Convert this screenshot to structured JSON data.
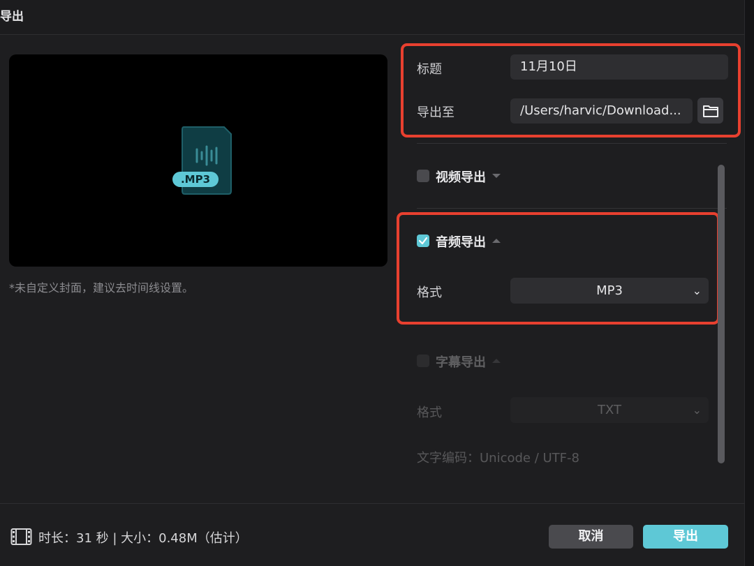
{
  "window": {
    "title": "导出"
  },
  "preview": {
    "file_badge": ".MP3",
    "cover_note": "*未自定义封面，建议去时间线设置。"
  },
  "general": {
    "title_label": "标题",
    "title_value": "11月10日",
    "export_to_label": "导出至",
    "export_path": "/Users/harvic/Download...",
    "folder_icon": "folder-icon"
  },
  "video_export": {
    "label": "视频导出",
    "checked": false
  },
  "audio_export": {
    "label": "音频导出",
    "checked": true,
    "format_label": "格式",
    "format_value": "MP3"
  },
  "subtitle_export": {
    "label": "字幕导出",
    "checked": false,
    "format_label": "格式",
    "format_value": "TXT",
    "encoding_text": "文字编码：Unicode / UTF-8"
  },
  "footer": {
    "info": "时长：31 秒 | 大小：0.48M（估计）",
    "cancel_label": "取消",
    "export_label": "导出"
  },
  "colors": {
    "accent": "#5ec8d6",
    "highlight_box": "#e8402f"
  }
}
